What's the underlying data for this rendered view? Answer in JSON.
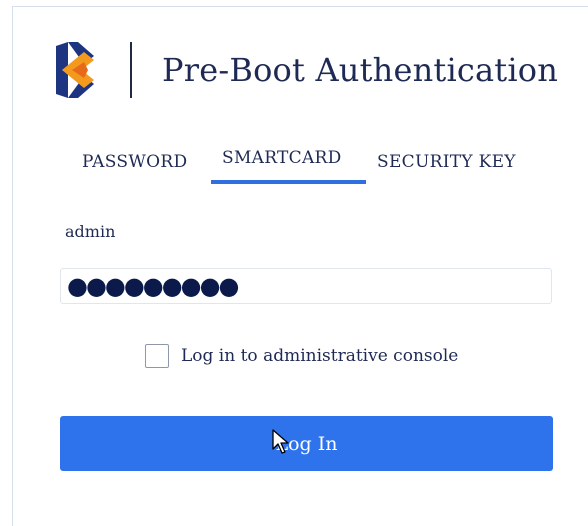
{
  "header": {
    "title": "Pre-Boot Authentication",
    "logo_icon": "brand-chevron-logo-icon"
  },
  "tabs": [
    {
      "label": "PASSWORD",
      "active": false
    },
    {
      "label": "SMARTCARD",
      "active": true
    },
    {
      "label": "SECURITY KEY",
      "active": false
    }
  ],
  "form": {
    "username_label": "admin",
    "password_mask": "●●●●●●●●●",
    "checkbox_label": "Log in to administrative console",
    "checkbox_checked": false,
    "login_label": "Log In"
  },
  "colors": {
    "accent": "#2f73ec",
    "text": "#1f2a54",
    "logo_orange": "#f39a1e",
    "logo_navy": "#1d3580"
  }
}
